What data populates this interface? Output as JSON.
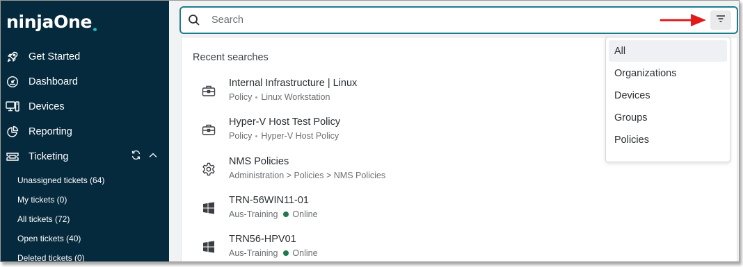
{
  "app": {
    "logo_part1": "ninja",
    "logo_part2": "One"
  },
  "sidebar": {
    "items": [
      {
        "label": "Get Started",
        "icon": "rocket-icon"
      },
      {
        "label": "Dashboard",
        "icon": "gauge-icon"
      },
      {
        "label": "Devices",
        "icon": "devices-icon"
      },
      {
        "label": "Reporting",
        "icon": "pie-chart-icon"
      },
      {
        "label": "Ticketing",
        "icon": "ticket-icon"
      }
    ],
    "ticketing_sub": [
      {
        "label": "Unassigned tickets (64)"
      },
      {
        "label": "My tickets (0)"
      },
      {
        "label": "All tickets (72)"
      },
      {
        "label": "Open tickets (40)"
      },
      {
        "label": "Deleted tickets (0)"
      }
    ]
  },
  "search": {
    "placeholder": "Search",
    "value": ""
  },
  "results": {
    "title": "Recent searches",
    "items": [
      {
        "title": "Internal Infrastructure | Linux",
        "sub1": "Policy",
        "sub2": "Linux Workstation",
        "icon": "briefcase-icon"
      },
      {
        "title": "Hyper-V Host Test Policy",
        "sub1": "Policy",
        "sub2": "Hyper-V Host Policy",
        "icon": "briefcase-icon"
      },
      {
        "title": "NMS Policies",
        "sub1": "Administration > Policies > NMS Policies",
        "icon": "gear-icon"
      },
      {
        "title": "TRN-56WIN11-01",
        "sub1": "Aus-Training",
        "status": "Online",
        "icon": "windows-icon"
      },
      {
        "title": "TRN56-HPV01",
        "sub1": "Aus-Training",
        "status": "Online",
        "icon": "windows-icon"
      }
    ]
  },
  "filter_menu": {
    "options": [
      "All",
      "Organizations",
      "Devices",
      "Groups",
      "Policies"
    ],
    "selected": "All"
  },
  "colors": {
    "sidebar_bg": "#062a3d",
    "accent": "#1b7c8a",
    "online": "#1f7a4d",
    "arrow": "#e01b1b"
  }
}
